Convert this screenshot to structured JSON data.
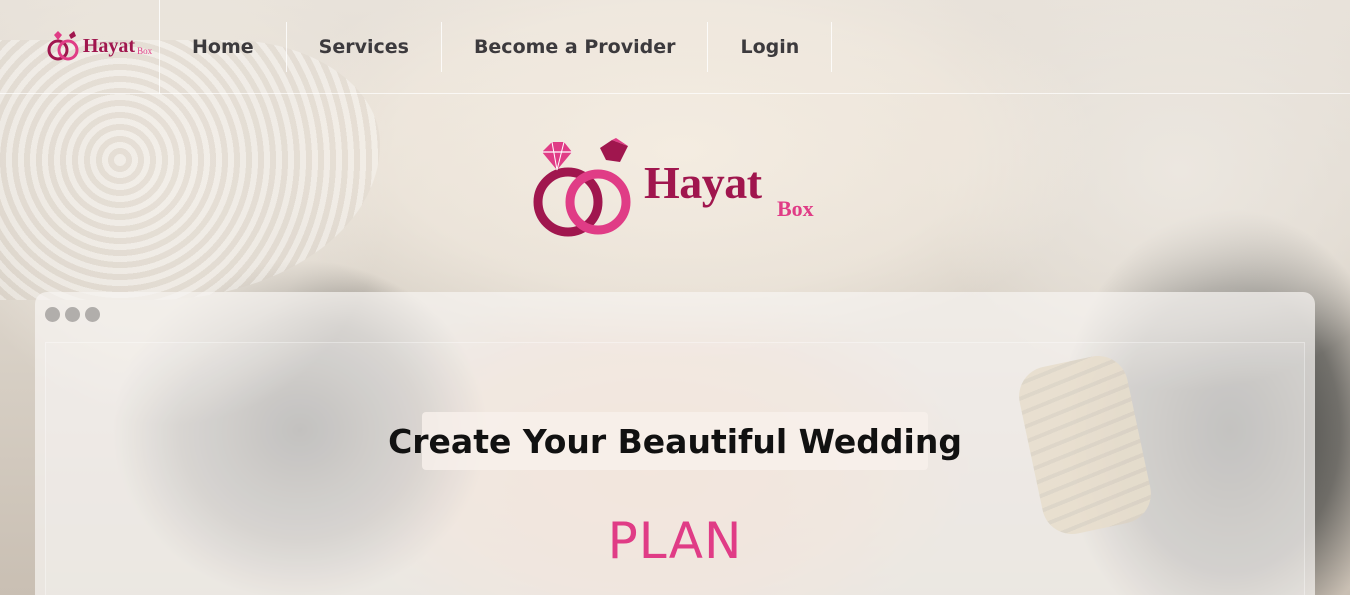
{
  "brand": {
    "name": "Hayat",
    "suffix": "Box",
    "primary_color": "#a0164e",
    "accent_color": "#e03c86"
  },
  "nav": {
    "items": [
      {
        "label": "Home"
      },
      {
        "label": "Services"
      },
      {
        "label": "Become a Provider"
      },
      {
        "label": "Login"
      }
    ]
  },
  "hero": {
    "headline": "Create Your Beautiful Wedding",
    "rotating_word": "PLAN",
    "frame_dots": [
      "dot",
      "dot",
      "dot"
    ]
  },
  "icons": {
    "logo_mark": "wedding-rings-diamond-icon"
  }
}
